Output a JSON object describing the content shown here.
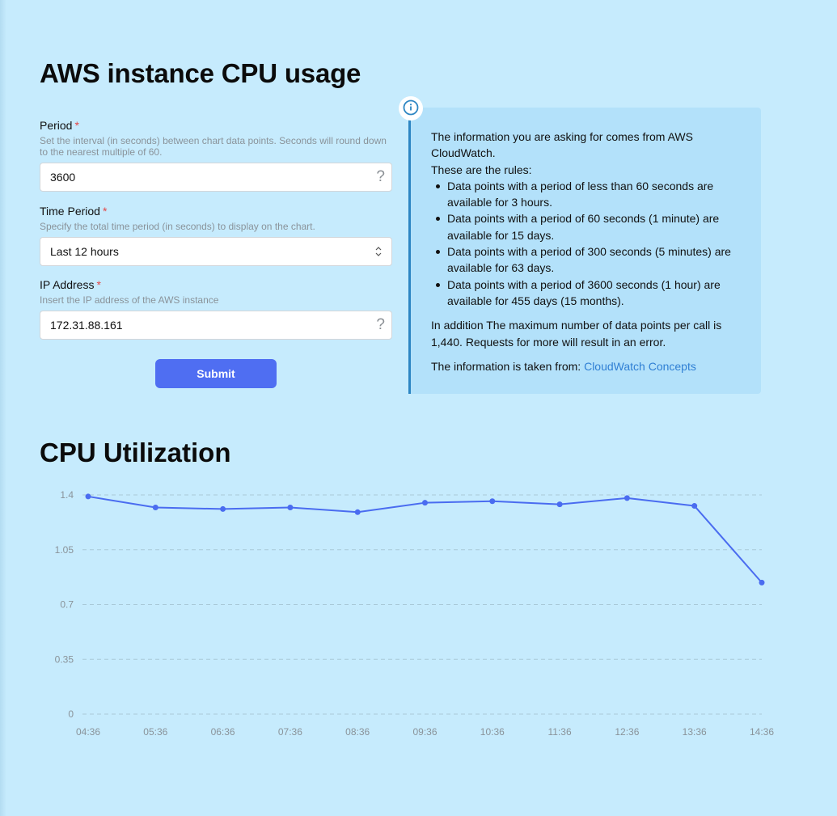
{
  "page": {
    "title": "AWS instance CPU usage"
  },
  "form": {
    "period": {
      "label": "Period",
      "required_mark": "*",
      "help": "Set the interval (in seconds) between chart data points. Seconds will round down to the nearest multiple of 60.",
      "value": "3600",
      "tooltip_icon": "?"
    },
    "time_period": {
      "label": "Time Period",
      "required_mark": "*",
      "help": "Specify the total time period (in seconds) to display on the chart.",
      "selected": "Last 12 hours"
    },
    "ip_address": {
      "label": "IP Address",
      "required_mark": "*",
      "help": "Insert the IP address of the AWS instance",
      "value": "172.31.88.161",
      "tooltip_icon": "?"
    },
    "submit_label": "Submit"
  },
  "info": {
    "intro": "The information you are asking for comes from AWS CloudWatch.",
    "rules_heading": "These are the rules:",
    "rules": [
      "Data points with a period of less than 60 seconds are available for 3 hours.",
      "Data points with a period of 60 seconds (1 minute) are available for 15 days.",
      "Data points with a period of 300 seconds (5 minutes) are available for 63 days.",
      "Data points with a period of 3600 seconds (1 hour) are available for 455 days (15 months)."
    ],
    "addition": "In addition The maximum number of data points per call is 1,440. Requests for more will result in an error.",
    "source_prefix": "The information is taken from: ",
    "source_link": "CloudWatch Concepts"
  },
  "chart_section": {
    "title": "CPU Utilization"
  },
  "colors": {
    "background": "#c6ebfd",
    "accent": "#4f6ef2",
    "line": "#4a6cf0",
    "info_border": "#2d86c3",
    "link": "#2f7fd4"
  },
  "chart_data": {
    "type": "line",
    "title": "CPU Utilization",
    "x": [
      "04:36",
      "05:36",
      "06:36",
      "07:36",
      "08:36",
      "09:36",
      "10:36",
      "11:36",
      "12:36",
      "13:36",
      "14:36"
    ],
    "series": [
      {
        "values": [
          1.39,
          1.32,
          1.31,
          1.32,
          1.29,
          1.35,
          1.36,
          1.34,
          1.38,
          1.33,
          0.84
        ]
      }
    ],
    "yticks": [
      "0",
      "0.35",
      "0.7",
      "1.05",
      "1.4"
    ],
    "ylim": [
      0,
      1.4
    ],
    "grid": "horizontal-dashed"
  }
}
